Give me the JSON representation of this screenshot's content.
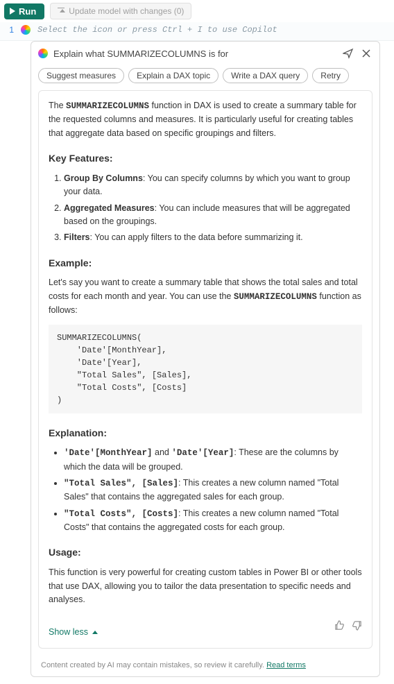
{
  "toolbar": {
    "run_label": "Run",
    "update_label": "Update model with changes (0)"
  },
  "editor": {
    "line_number": "1",
    "placeholder": "Select the icon or press Ctrl + I to use Copilot"
  },
  "panel": {
    "prompt": "Explain what SUMMARIZECOLUMNS is for",
    "chips": {
      "suggest": "Suggest measures",
      "explain": "Explain a DAX topic",
      "write": "Write a DAX query",
      "retry": "Retry"
    }
  },
  "content": {
    "intro_pre": "The ",
    "intro_func": "SUMMARIZECOLUMNS",
    "intro_post": " function in DAX is used to create a summary table for the requested columns and measures. It is particularly useful for creating tables that aggregate data based on specific groupings and filters.",
    "h_key": "Key Features:",
    "kf1_b": "Group By Columns",
    "kf1_t": ": You can specify columns by which you want to group your data.",
    "kf2_b": "Aggregated Measures",
    "kf2_t": ": You can include measures that will be aggregated based on the groupings.",
    "kf3_b": "Filters",
    "kf3_t": ": You can apply filters to the data before summarizing it.",
    "h_example": "Example:",
    "example_pre": "Let's say you want to create a summary table that shows the total sales and total costs for each month and year. You can use the ",
    "example_func": "SUMMARIZECOLUMNS",
    "example_post": " function as follows:",
    "code": "SUMMARIZECOLUMNS(\n    'Date'[MonthYear],\n    'Date'[Year],\n    \"Total Sales\", [Sales],\n    \"Total Costs\", [Costs]\n)",
    "h_explanation": "Explanation:",
    "ex1_code": "'Date'[MonthYear]",
    "ex1_and": " and ",
    "ex1_code2": "'Date'[Year]",
    "ex1_t": ": These are the columns by which the data will be grouped.",
    "ex2_code": "\"Total Sales\", [Sales]",
    "ex2_t": ": This creates a new column named \"Total Sales\" that contains the aggregated sales for each group.",
    "ex3_code": "\"Total Costs\", [Costs]",
    "ex3_t": ": This creates a new column named \"Total Costs\" that contains the aggregated costs for each group.",
    "h_usage": "Usage:",
    "usage_text": "This function is very powerful for creating custom tables in Power BI or other tools that use DAX, allowing you to tailor the data presentation to specific needs and analyses.",
    "show_less": "Show less"
  },
  "footer": {
    "text": "Content created by AI may contain mistakes, so review it carefully. ",
    "link": "Read terms"
  }
}
